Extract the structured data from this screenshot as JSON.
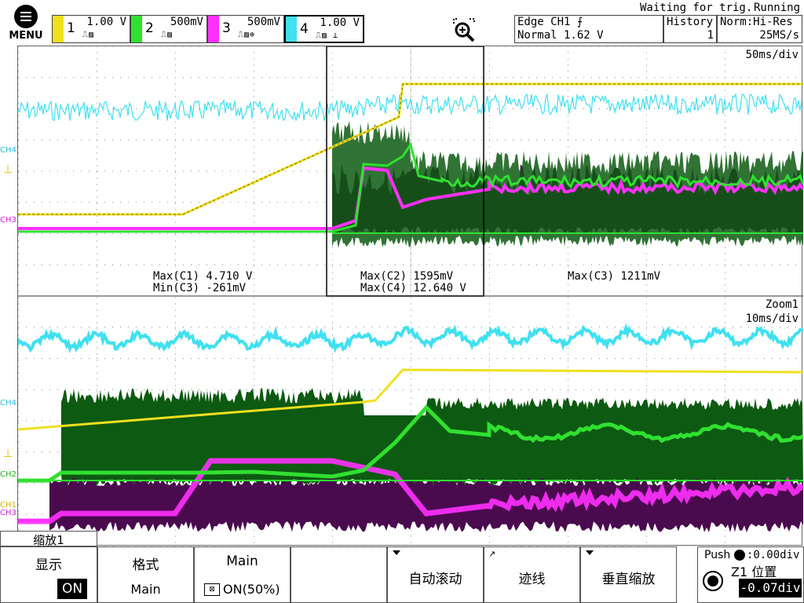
{
  "menu": {
    "label": "MENU"
  },
  "channels": [
    {
      "num": "1",
      "scale": "1.00 V",
      "color": "#f0e020",
      "icons": "⎍▨"
    },
    {
      "num": "2",
      "scale": "500mV",
      "color": "#30e030",
      "icons": "⎍▨"
    },
    {
      "num": "3",
      "scale": "500mV",
      "color": "#ff30ff",
      "icons": "⎍▨⊕"
    },
    {
      "num": "4",
      "scale": "1.00 V",
      "color": "#40e0f0",
      "icons": "⎍▨ ⊥"
    }
  ],
  "status": {
    "waiting": "Waiting for trig.",
    "running": "Running"
  },
  "trigger": {
    "line1": "Edge CH1 ⨍",
    "line2": "Normal 1.62 V"
  },
  "history": {
    "label": "History",
    "value": "1"
  },
  "acq": {
    "mode": "Norm:Hi-Res",
    "rate": "25MS/s"
  },
  "main_window": {
    "timebase": "50ms/div",
    "measurements": [
      {
        "line1": "Max(C1)  4.710 V",
        "line2": "Min(C3) -261mV"
      },
      {
        "line1": "Max(C2)  1595mV",
        "line2": "Max(C4)  12.640 V"
      },
      {
        "line1": "Max(C3)  1211mV",
        "line2": ""
      }
    ]
  },
  "zoom_window": {
    "label": "Zoom1",
    "timebase": "10ms/div"
  },
  "markers": {
    "ch4": "CH4",
    "ch2": "CH2",
    "ch1": "CH1",
    "ch3": "CH3",
    "trig": "T"
  },
  "tab": {
    "label": "缩放1"
  },
  "softkeys": [
    {
      "t1": "显示",
      "t2": "ON"
    },
    {
      "t1": "格式",
      "t2": "Main"
    },
    {
      "t1": "Main",
      "t2": "ON(50%)"
    },
    {
      "t1": "",
      "t2": ""
    },
    {
      "t1": "自动滚动",
      "t2": ""
    },
    {
      "t1": "迹线",
      "t2": ""
    },
    {
      "t1": "垂直缩放",
      "t2": ""
    }
  ],
  "position": {
    "push": "Push",
    "push_value": ":0.00div",
    "title": "Z1 位置",
    "value": "-0.07div"
  },
  "colors": {
    "ch1": "#f0e020",
    "ch2": "#30e030",
    "ch3": "#ff30ff",
    "ch4": "#40e0f0",
    "ch2_dark": "#0d5a12",
    "ch3_dark": "#4a0a4e"
  }
}
